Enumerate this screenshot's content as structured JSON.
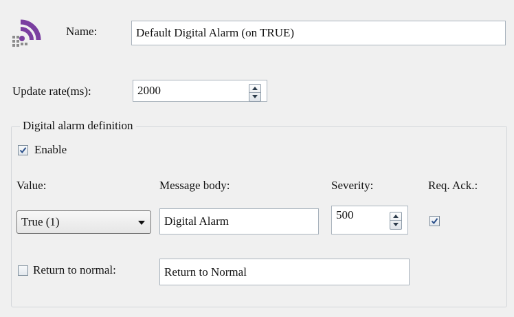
{
  "header": {
    "icon": "wifi-signal-icon",
    "name_label": "Name:",
    "name_value": "Default Digital Alarm (on TRUE)"
  },
  "update_rate": {
    "label": "Update rate(ms):",
    "value": "2000"
  },
  "group": {
    "title": "Digital alarm definition",
    "enable_label": "Enable",
    "enable_checked": true,
    "columns": {
      "value": "Value:",
      "message_body": "Message body:",
      "severity": "Severity:",
      "req_ack": "Req. Ack.:"
    },
    "row": {
      "value_selected": "True (1)",
      "message_body": "Digital Alarm",
      "severity": "500",
      "req_ack_checked": true
    },
    "return_to_normal": {
      "label": "Return to normal:",
      "checked": false,
      "message": "Return to Normal"
    }
  },
  "colors": {
    "icon_purple": "#7a3fa0",
    "icon_grey": "#8c8c8c",
    "check_blue": "#2a4f8a"
  }
}
